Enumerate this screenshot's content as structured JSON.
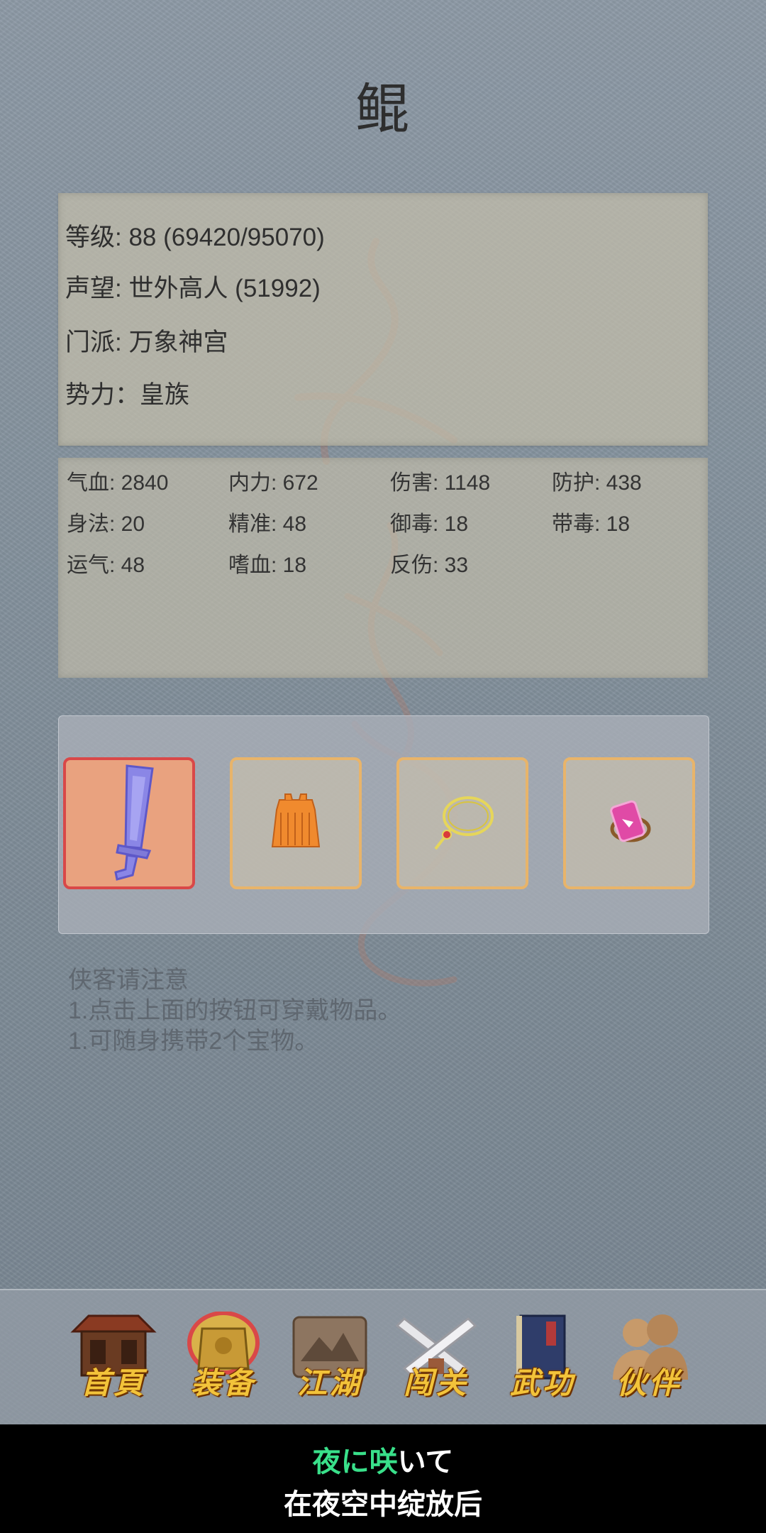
{
  "character": {
    "name": "鲲"
  },
  "info": {
    "level": "等级: 88 (69420/95070)",
    "reputation": "声望: 世外高人 (51992)",
    "sect": "门派: 万象神宫",
    "faction": "势力：皇族"
  },
  "stats": [
    {
      "label": "气血: 2840"
    },
    {
      "label": "内力: 672"
    },
    {
      "label": "伤害: 1148"
    },
    {
      "label": "防护: 438"
    },
    {
      "label": "身法: 20"
    },
    {
      "label": "精准: 48"
    },
    {
      "label": "御毒: 18"
    },
    {
      "label": "带毒: 18"
    },
    {
      "label": "运气: 48"
    },
    {
      "label": "嗜血: 18"
    },
    {
      "label": "反伤: 33"
    }
  ],
  "equipment": [
    {
      "icon": "sword-icon",
      "selected": true
    },
    {
      "icon": "armor-icon",
      "selected": false
    },
    {
      "icon": "necklace-icon",
      "selected": false
    },
    {
      "icon": "ring-icon",
      "selected": false
    }
  ],
  "notes": {
    "title": "侠客请注意",
    "line1": "1.点击上面的按钮可穿戴物品。",
    "line2": "1.可随身携带2个宝物。"
  },
  "nav": [
    {
      "label": "首頁",
      "icon": "house-icon"
    },
    {
      "label": "装备",
      "icon": "armor-icon",
      "active": true
    },
    {
      "label": "江湖",
      "icon": "scroll-map-icon"
    },
    {
      "label": "闯关",
      "icon": "crossed-swords-icon"
    },
    {
      "label": "武功",
      "icon": "book-icon"
    },
    {
      "label": "伙伴",
      "icon": "companions-icon"
    }
  ],
  "subtitle": {
    "line1_a": "夜に",
    "line1_b": "咲",
    "line1_c": "いて",
    "line2": "在夜空中绽放后"
  },
  "colors": {
    "slot_border": "#e8b46a",
    "slot_active_border": "#d94848",
    "slot_active_bg": "#e9a27f",
    "nav_label": "#f2c33a",
    "subtitle_highlight": "#39e08a"
  }
}
